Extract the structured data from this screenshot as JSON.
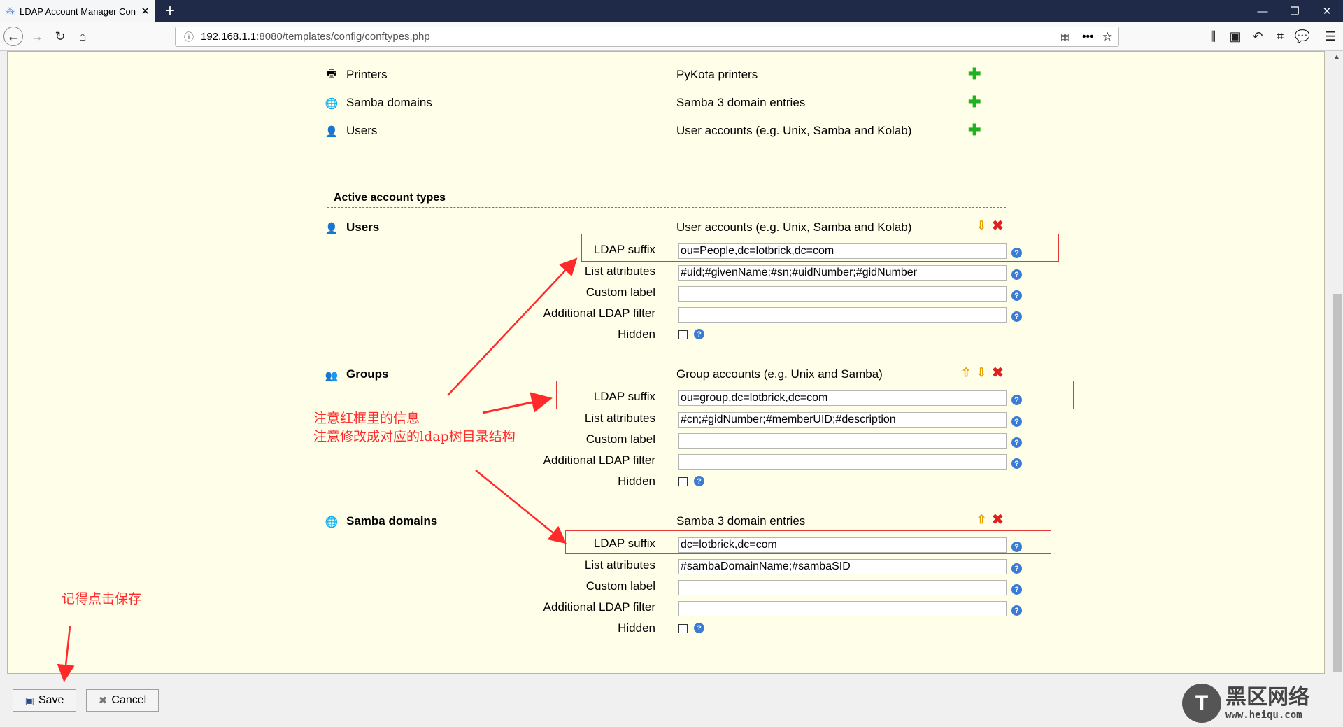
{
  "browser": {
    "tab_title": "LDAP Account Manager Con",
    "url_host": "192.168.1.1",
    "url_path": ":8080/templates/config/conftypes.php",
    "new_tab": "+"
  },
  "available_types": [
    {
      "name": "Printers",
      "desc": "PyKota printers"
    },
    {
      "name": "Samba domains",
      "desc": "Samba 3 domain entries"
    },
    {
      "name": "Users",
      "desc": "User accounts (e.g. Unix, Samba and Kolab)"
    }
  ],
  "section_title": "Active account types",
  "labels": {
    "ldap_suffix": "LDAP suffix",
    "list_attributes": "List attributes",
    "custom_label": "Custom label",
    "additional_filter": "Additional LDAP filter",
    "hidden": "Hidden"
  },
  "active_types": [
    {
      "name": "Users",
      "desc": "User accounts (e.g. Unix, Samba and Kolab)",
      "ldap_suffix": "ou=People,dc=lotbrick,dc=com",
      "list_attributes": "#uid;#givenName;#sn;#uidNumber;#gidNumber",
      "custom_label": "",
      "filter": ""
    },
    {
      "name": "Groups",
      "desc": "Group accounts (e.g. Unix and Samba)",
      "ldap_suffix": "ou=group,dc=lotbrick,dc=com",
      "list_attributes": "#cn;#gidNumber;#memberUID;#description",
      "custom_label": "",
      "filter": ""
    },
    {
      "name": "Samba domains",
      "desc": "Samba 3 domain entries",
      "ldap_suffix": "dc=lotbrick,dc=com",
      "list_attributes": "#sambaDomainName;#sambaSID",
      "custom_label": "",
      "filter": ""
    }
  ],
  "annotations": {
    "note1": "注意红框里的信息",
    "note2": "注意修改成对应的ldap树目录结构",
    "save_note": "记得点击保存"
  },
  "buttons": {
    "save": "Save",
    "cancel": "Cancel"
  },
  "watermark": {
    "brand": "黑区网络",
    "site": "www.heiqu.com"
  },
  "colors": {
    "annotation": "#ff2a2a",
    "content_bg": "#ffffe9",
    "titlebar": "#1e2a48"
  }
}
